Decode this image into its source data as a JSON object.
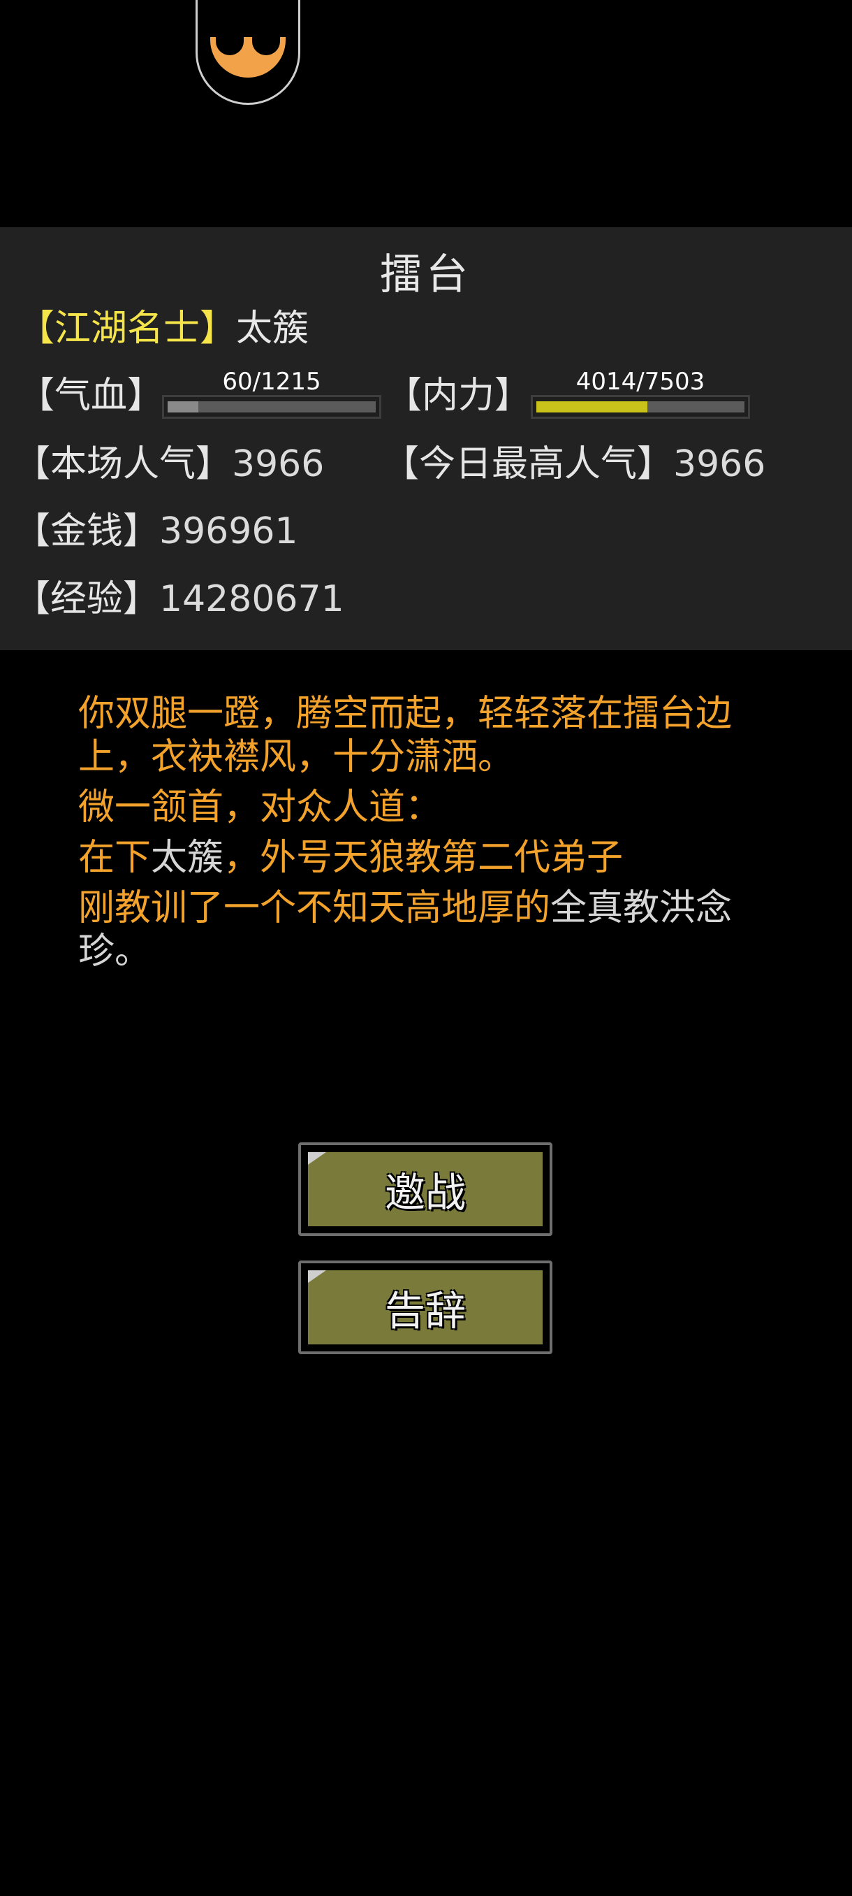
{
  "title": "擂台",
  "player": {
    "rank": "【江湖名士】",
    "name": "太簇"
  },
  "stats": {
    "hp_label": "【气血】",
    "hp_text": "60/1215",
    "hp_fraction": 0.049,
    "mp_label": "【内力】",
    "mp_text": "4014/7503",
    "mp_fraction": 0.535,
    "popularity_label": "【本场人气】",
    "popularity": "3966",
    "top_popularity_label": "【今日最高人气】",
    "top_popularity": "3966",
    "money_label": "【金钱】",
    "money": "396961",
    "exp_label": "【经验】",
    "exp": "14280671"
  },
  "story": {
    "line1": "你双腿一蹬，腾空而起，轻轻落在擂台边上，衣袂襟风，十分潇洒。",
    "line2": "微一颔首，对众人道：",
    "line3_a": "在下",
    "line3_name": "太簇",
    "line3_b": "，外号天狼教第二代弟子",
    "line4_a": "刚教训了一个不知天高地厚的",
    "line4_b": "全真教洪念珍",
    "line4_c": "。"
  },
  "buttons": {
    "challenge": "邀战",
    "leave": "告辞"
  },
  "colors": {
    "hp_fill": "#5b5b5b",
    "mp_fill": "#c8c21a",
    "button_bg": "#7a7a3b",
    "story_text": "#f3a32b"
  }
}
